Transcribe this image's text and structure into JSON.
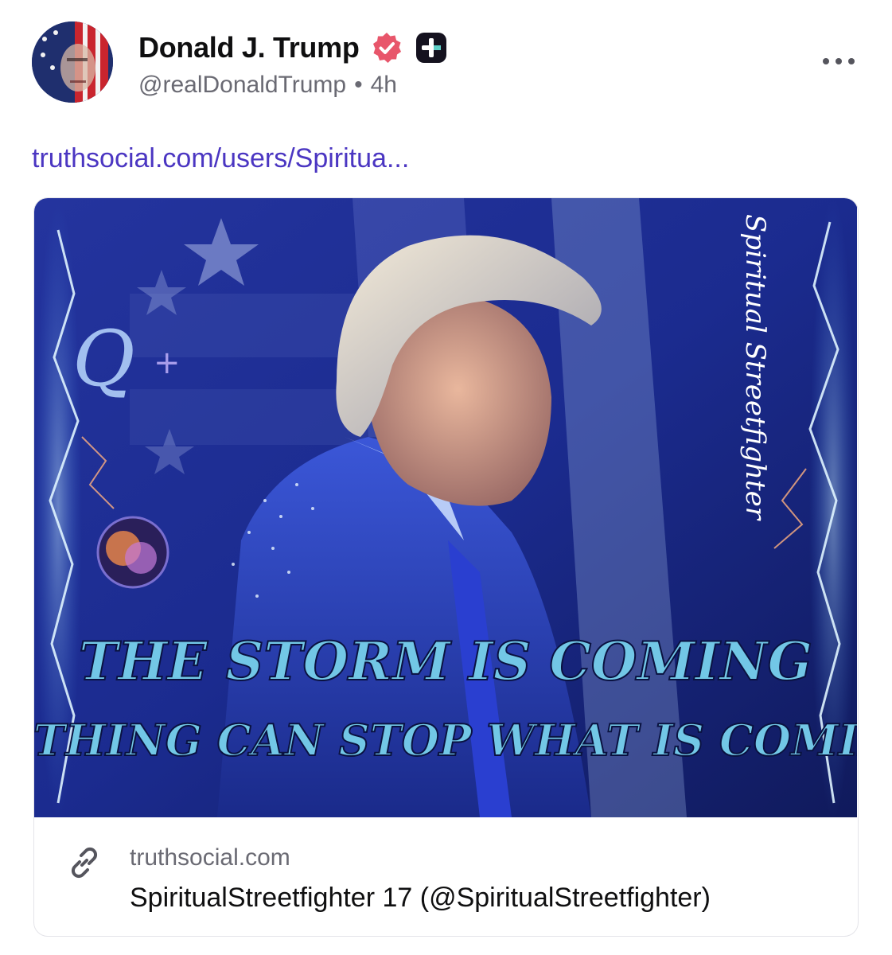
{
  "post": {
    "author": {
      "display_name": "Donald J. Trump",
      "handle": "@realDonaldTrump",
      "verified_badge_icon": "verified-badge-icon",
      "plus_badge_icon": "truth-plus-icon"
    },
    "separator": "•",
    "timestamp": "4h",
    "more_icon": "more-horizontal-icon",
    "link_text": "truthsocial.com/users/Spiritua..."
  },
  "card": {
    "image": {
      "headline_line1": "THE STORM IS COMING",
      "headline_line2": "NOTHING CAN STOP WHAT IS COMING",
      "watermark": "Spiritual Streetfighter",
      "q_mark": "Q",
      "q_plus": "+"
    },
    "link_icon": "chain-link-icon",
    "domain": "truthsocial.com",
    "title": "SpiritualStreetfighter 17 (@SpiritualStreetfighter)"
  },
  "colors": {
    "link": "#4b36c2",
    "verified": "#e8566b",
    "muted": "#6a6a73",
    "image_bg": "#1b2b8f",
    "headline": "#72c7e6"
  }
}
